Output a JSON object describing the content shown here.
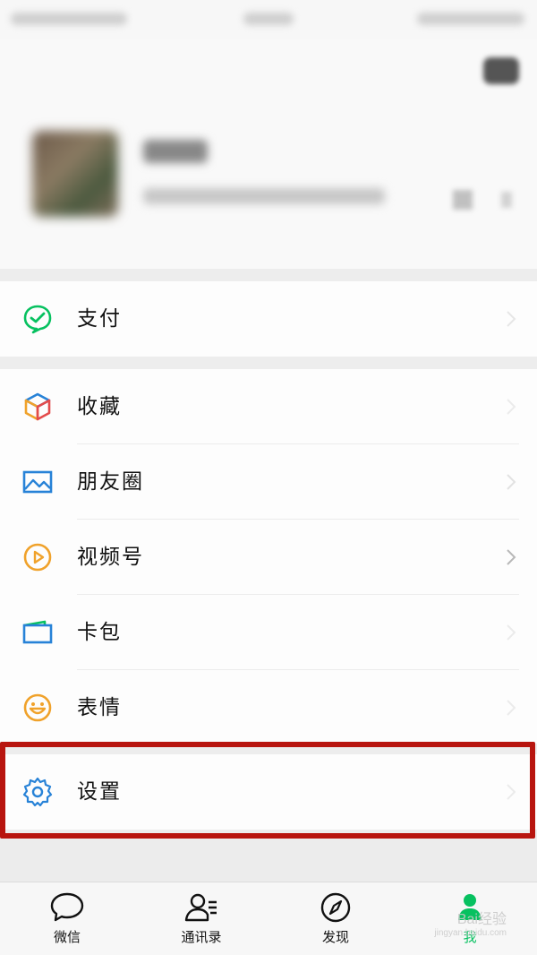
{
  "menu": {
    "pay": {
      "label": "支付",
      "icon": "wechat-pay-icon"
    },
    "items": [
      {
        "label": "收藏",
        "icon": "favorites-cube-icon"
      },
      {
        "label": "朋友圈",
        "icon": "moments-image-icon"
      },
      {
        "label": "视频号",
        "icon": "channels-play-icon"
      },
      {
        "label": "卡包",
        "icon": "card-wallet-icon"
      },
      {
        "label": "表情",
        "icon": "sticker-smile-icon"
      }
    ],
    "settings": {
      "label": "设置",
      "icon": "gear-icon"
    }
  },
  "tabs": [
    {
      "label": "微信",
      "icon": "chat-bubble-icon",
      "active": false
    },
    {
      "label": "通讯录",
      "icon": "contacts-icon",
      "active": false
    },
    {
      "label": "发现",
      "icon": "compass-icon",
      "active": false
    },
    {
      "label": "我",
      "icon": "me-person-icon",
      "active": true
    }
  ],
  "colors": {
    "accent": "#07c160",
    "highlight_border": "#b8150f",
    "icon_blue": "#2782d7",
    "icon_orange": "#f0a22b"
  },
  "watermark": {
    "text": "Bai经验",
    "sub": "jingyan.baidu.com"
  }
}
